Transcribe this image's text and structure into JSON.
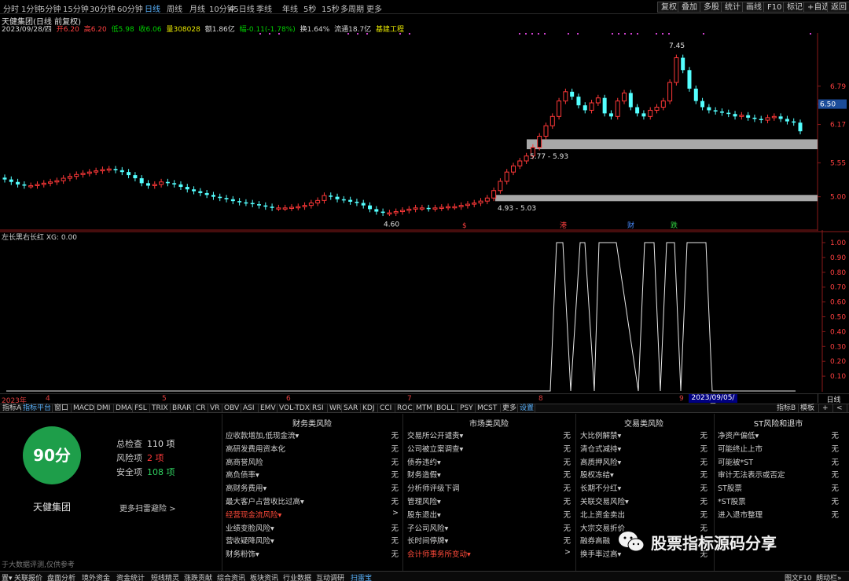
{
  "toolbar": {
    "timeframes": [
      "分时",
      "1分钟",
      "5分钟",
      "15分钟",
      "30分钟",
      "60分钟",
      "日线",
      "周线",
      "月线",
      "10分钟",
      "45日线",
      "季线",
      "年线",
      "5秒",
      "15秒",
      "多周期",
      "更多"
    ],
    "active_timeframe": "日线",
    "right_buttons": [
      "复权",
      "叠加",
      "多股",
      "统计",
      "画线",
      "F10",
      "标记",
      "+自选",
      "返回"
    ]
  },
  "header": {
    "title": "天健集团(日线 前复权)",
    "date": "2023/09/28/四",
    "open": "开6.20",
    "high": "高6.20",
    "low": "低5.98",
    "close": "收6.06",
    "volume": "量308028",
    "amount": "额1.86亿",
    "change": "幅-0.11(-1.78%)",
    "turnover": "换1.64%",
    "float_cap": "流通18.7亿",
    "sector": "基建工程"
  },
  "price_axis": {
    "labels": [
      "6.79",
      "6.50",
      "6.17",
      "5.55",
      "5.00"
    ],
    "current_price_tag": "6.50"
  },
  "chart_annotations": {
    "high_label": "7.45",
    "low_label": "4.60",
    "zone_upper_label": "5.77 - 5.93",
    "zone_lower_label": "4.93 - 5.03",
    "event_markers": [
      "$",
      "港",
      "财",
      "跌"
    ]
  },
  "indicator": {
    "title": "左长黑右长红  XG: 0.00",
    "axis_labels": [
      "1.00",
      "0.90",
      "0.80",
      "0.70",
      "0.60",
      "0.50",
      "0.40",
      "0.30",
      "0.20",
      "0.10"
    ]
  },
  "date_axis": {
    "labels": [
      "2023年",
      "4",
      "5",
      "6",
      "7",
      "8",
      "9"
    ],
    "selected_date": "2023/09/05/二",
    "period_button": "日线"
  },
  "indicator_tabs": {
    "left": [
      "指标A",
      "指标平台",
      "窗口",
      "MACD",
      "DMI",
      "DMA",
      "FSL",
      "TRIX",
      "BRAR",
      "CR",
      "VR",
      "OBV",
      "ASI",
      "EMV",
      "VOL-TDX",
      "RSI",
      "WR",
      "SAR",
      "KDJ",
      "CCI",
      "ROC",
      "MTM",
      "BOLL",
      "PSY",
      "MCST",
      "更多",
      "设置"
    ],
    "right": [
      "指标B",
      "模板",
      "+",
      "<"
    ]
  },
  "risk_panel": {
    "score": "90分",
    "company": "天健集团",
    "stats": [
      {
        "label": "总检查",
        "value": "110 项",
        "color": "#e0e0e0"
      },
      {
        "label": "风险项",
        "value": "2 项",
        "color": "#ff3a3a"
      },
      {
        "label": "安全项",
        "value": "108 项",
        "color": "#30d060"
      }
    ],
    "more_link": "更多扫雷避险 >",
    "disclaimer": "于大数据评测,仅供参考",
    "columns": [
      {
        "header": "财务类风险",
        "rows": [
          {
            "label": "应收款增加,低现金流▾",
            "value": "无",
            "alert": false
          },
          {
            "label": "高研发费用资本化",
            "value": "无",
            "alert": false
          },
          {
            "label": "高商誉风险",
            "value": "无",
            "alert": false
          },
          {
            "label": "高负债率▾",
            "value": "无",
            "alert": false
          },
          {
            "label": "高财务费用▾",
            "value": "无",
            "alert": false
          },
          {
            "label": "最大客户占营收比过高▾",
            "value": "无",
            "alert": false
          },
          {
            "label": "经营现金流风险▾",
            "value": ">",
            "alert": true
          },
          {
            "label": "业绩变脸风险▾",
            "value": "无",
            "alert": false
          },
          {
            "label": "营收疑降风险▾",
            "value": "无",
            "alert": false
          },
          {
            "label": "财务粉饰▾",
            "value": "无",
            "alert": false
          }
        ]
      },
      {
        "header": "市场类风险",
        "rows": [
          {
            "label": "交易所公开谴责▾",
            "value": "无",
            "alert": false
          },
          {
            "label": "公司被立案调查▾",
            "value": "无",
            "alert": false
          },
          {
            "label": "债券违约▾",
            "value": "无",
            "alert": false
          },
          {
            "label": "财务造假▾",
            "value": "无",
            "alert": false
          },
          {
            "label": "分析师评级下调",
            "value": "无",
            "alert": false
          },
          {
            "label": "管理风险▾",
            "value": "无",
            "alert": false
          },
          {
            "label": "股东退出▾",
            "value": "无",
            "alert": false
          },
          {
            "label": "子公司风险▾",
            "value": "无",
            "alert": false
          },
          {
            "label": "长时间停牌▾",
            "value": "无",
            "alert": false
          },
          {
            "label": "会计师事务所变动▾",
            "value": ">",
            "alert": true
          }
        ]
      },
      {
        "header": "交易类风险",
        "rows": [
          {
            "label": "大比例解禁▾",
            "value": "无",
            "alert": false
          },
          {
            "label": "清仓式减持▾",
            "value": "无",
            "alert": false
          },
          {
            "label": "高质押风险▾",
            "value": "无",
            "alert": false
          },
          {
            "label": "股权冻结▾",
            "value": "无",
            "alert": false
          },
          {
            "label": "长期不分红▾",
            "value": "无",
            "alert": false
          },
          {
            "label": "关联交易风险▾",
            "value": "无",
            "alert": false
          },
          {
            "label": "北上资金卖出",
            "value": "无",
            "alert": false
          },
          {
            "label": "大宗交易折价",
            "value": "无",
            "alert": false
          },
          {
            "label": "融券高融",
            "value": "无",
            "alert": false
          },
          {
            "label": "换手率过高▾",
            "value": "无",
            "alert": false
          }
        ]
      },
      {
        "header": "ST风险和退市",
        "rows": [
          {
            "label": "净资产偏低▾",
            "value": "无",
            "alert": false
          },
          {
            "label": "可能终止上市",
            "value": "无",
            "alert": false
          },
          {
            "label": "可能被*ST",
            "value": "无",
            "alert": false
          },
          {
            "label": "审计无法表示或否定",
            "value": "无",
            "alert": false
          },
          {
            "label": "ST股票",
            "value": "无",
            "alert": false
          },
          {
            "label": "*ST股票",
            "value": "无",
            "alert": false
          },
          {
            "label": "进入退市整理",
            "value": "无",
            "alert": false
          }
        ]
      }
    ]
  },
  "status_bar": {
    "tabs": [
      "置▾",
      "关联报价",
      "盘面分析",
      "境外资金",
      "资金统计",
      "短线精灵",
      "涨跌贡献",
      "综合资讯",
      "板块资讯",
      "行业数据",
      "互动调研",
      "扫雷宝"
    ],
    "highlighted": "扫雷宝",
    "right": [
      "图文F10",
      "朗动栏»"
    ]
  },
  "watermark": {
    "text": "股票指标源码分享",
    "icon": "wechat-icon"
  },
  "chart_data": [
    {
      "type": "candlestick",
      "title": "天健集团(日线 前复权)",
      "series": [
        {
          "values_ohlc_close_approx": [
            5.28,
            5.24,
            5.2,
            5.18,
            5.18,
            5.2,
            5.22,
            5.24,
            5.26,
            5.3,
            5.33,
            5.36,
            5.38,
            5.4,
            5.42,
            5.44,
            5.45,
            5.43,
            5.4,
            5.35,
            5.3,
            5.22,
            5.18,
            5.2,
            5.24,
            5.22,
            5.2,
            5.16,
            5.12,
            5.09,
            5.06,
            5.03,
            5.0,
            4.98,
            4.96,
            4.93,
            4.91,
            4.9,
            4.88,
            4.86,
            4.84,
            4.82,
            4.82,
            4.82,
            4.83,
            4.84,
            4.86,
            4.9,
            4.94,
            5.02,
            5.0,
            4.96,
            4.95,
            4.92,
            4.9,
            4.86,
            4.8,
            4.76,
            4.74,
            4.74,
            4.76,
            4.78,
            4.8,
            4.82,
            4.82,
            4.81,
            4.82,
            4.83,
            4.84,
            4.84,
            4.86,
            4.88,
            4.9,
            4.93,
            4.98,
            5.1,
            5.25,
            5.4,
            5.5,
            5.58,
            5.66,
            5.8,
            5.98,
            6.15,
            6.3,
            6.55,
            6.7,
            6.62,
            6.48,
            6.4,
            6.52,
            6.6,
            6.35,
            6.3,
            6.55,
            6.68,
            6.45,
            6.35,
            6.3,
            6.4,
            6.45,
            6.55,
            6.85,
            7.25,
            7.05,
            6.75,
            6.55,
            6.45,
            6.4,
            6.38,
            6.36,
            6.34,
            6.3,
            6.32,
            6.28,
            6.26,
            6.24,
            6.28,
            6.3,
            6.26,
            6.22,
            6.2,
            6.06
          ]
        }
      ],
      "annotations": [
        "7.45",
        "4.60",
        "5.77 - 5.93",
        "4.93 - 5.03"
      ],
      "ylim": [
        4.5,
        7.6
      ],
      "support_resistance_zones": [
        [
          5.77,
          5.93
        ],
        [
          4.93,
          5.03
        ]
      ]
    },
    {
      "type": "line",
      "title": "左长黑右长红  XG: 0.00",
      "series": [
        {
          "name": "XG",
          "values": [
            0,
            1,
            1,
            0,
            1,
            1,
            0,
            1,
            1,
            1,
            0,
            1,
            1,
            0,
            1,
            1,
            0,
            1,
            1,
            1,
            0,
            0
          ]
        }
      ],
      "ylim": [
        0,
        1
      ]
    }
  ]
}
